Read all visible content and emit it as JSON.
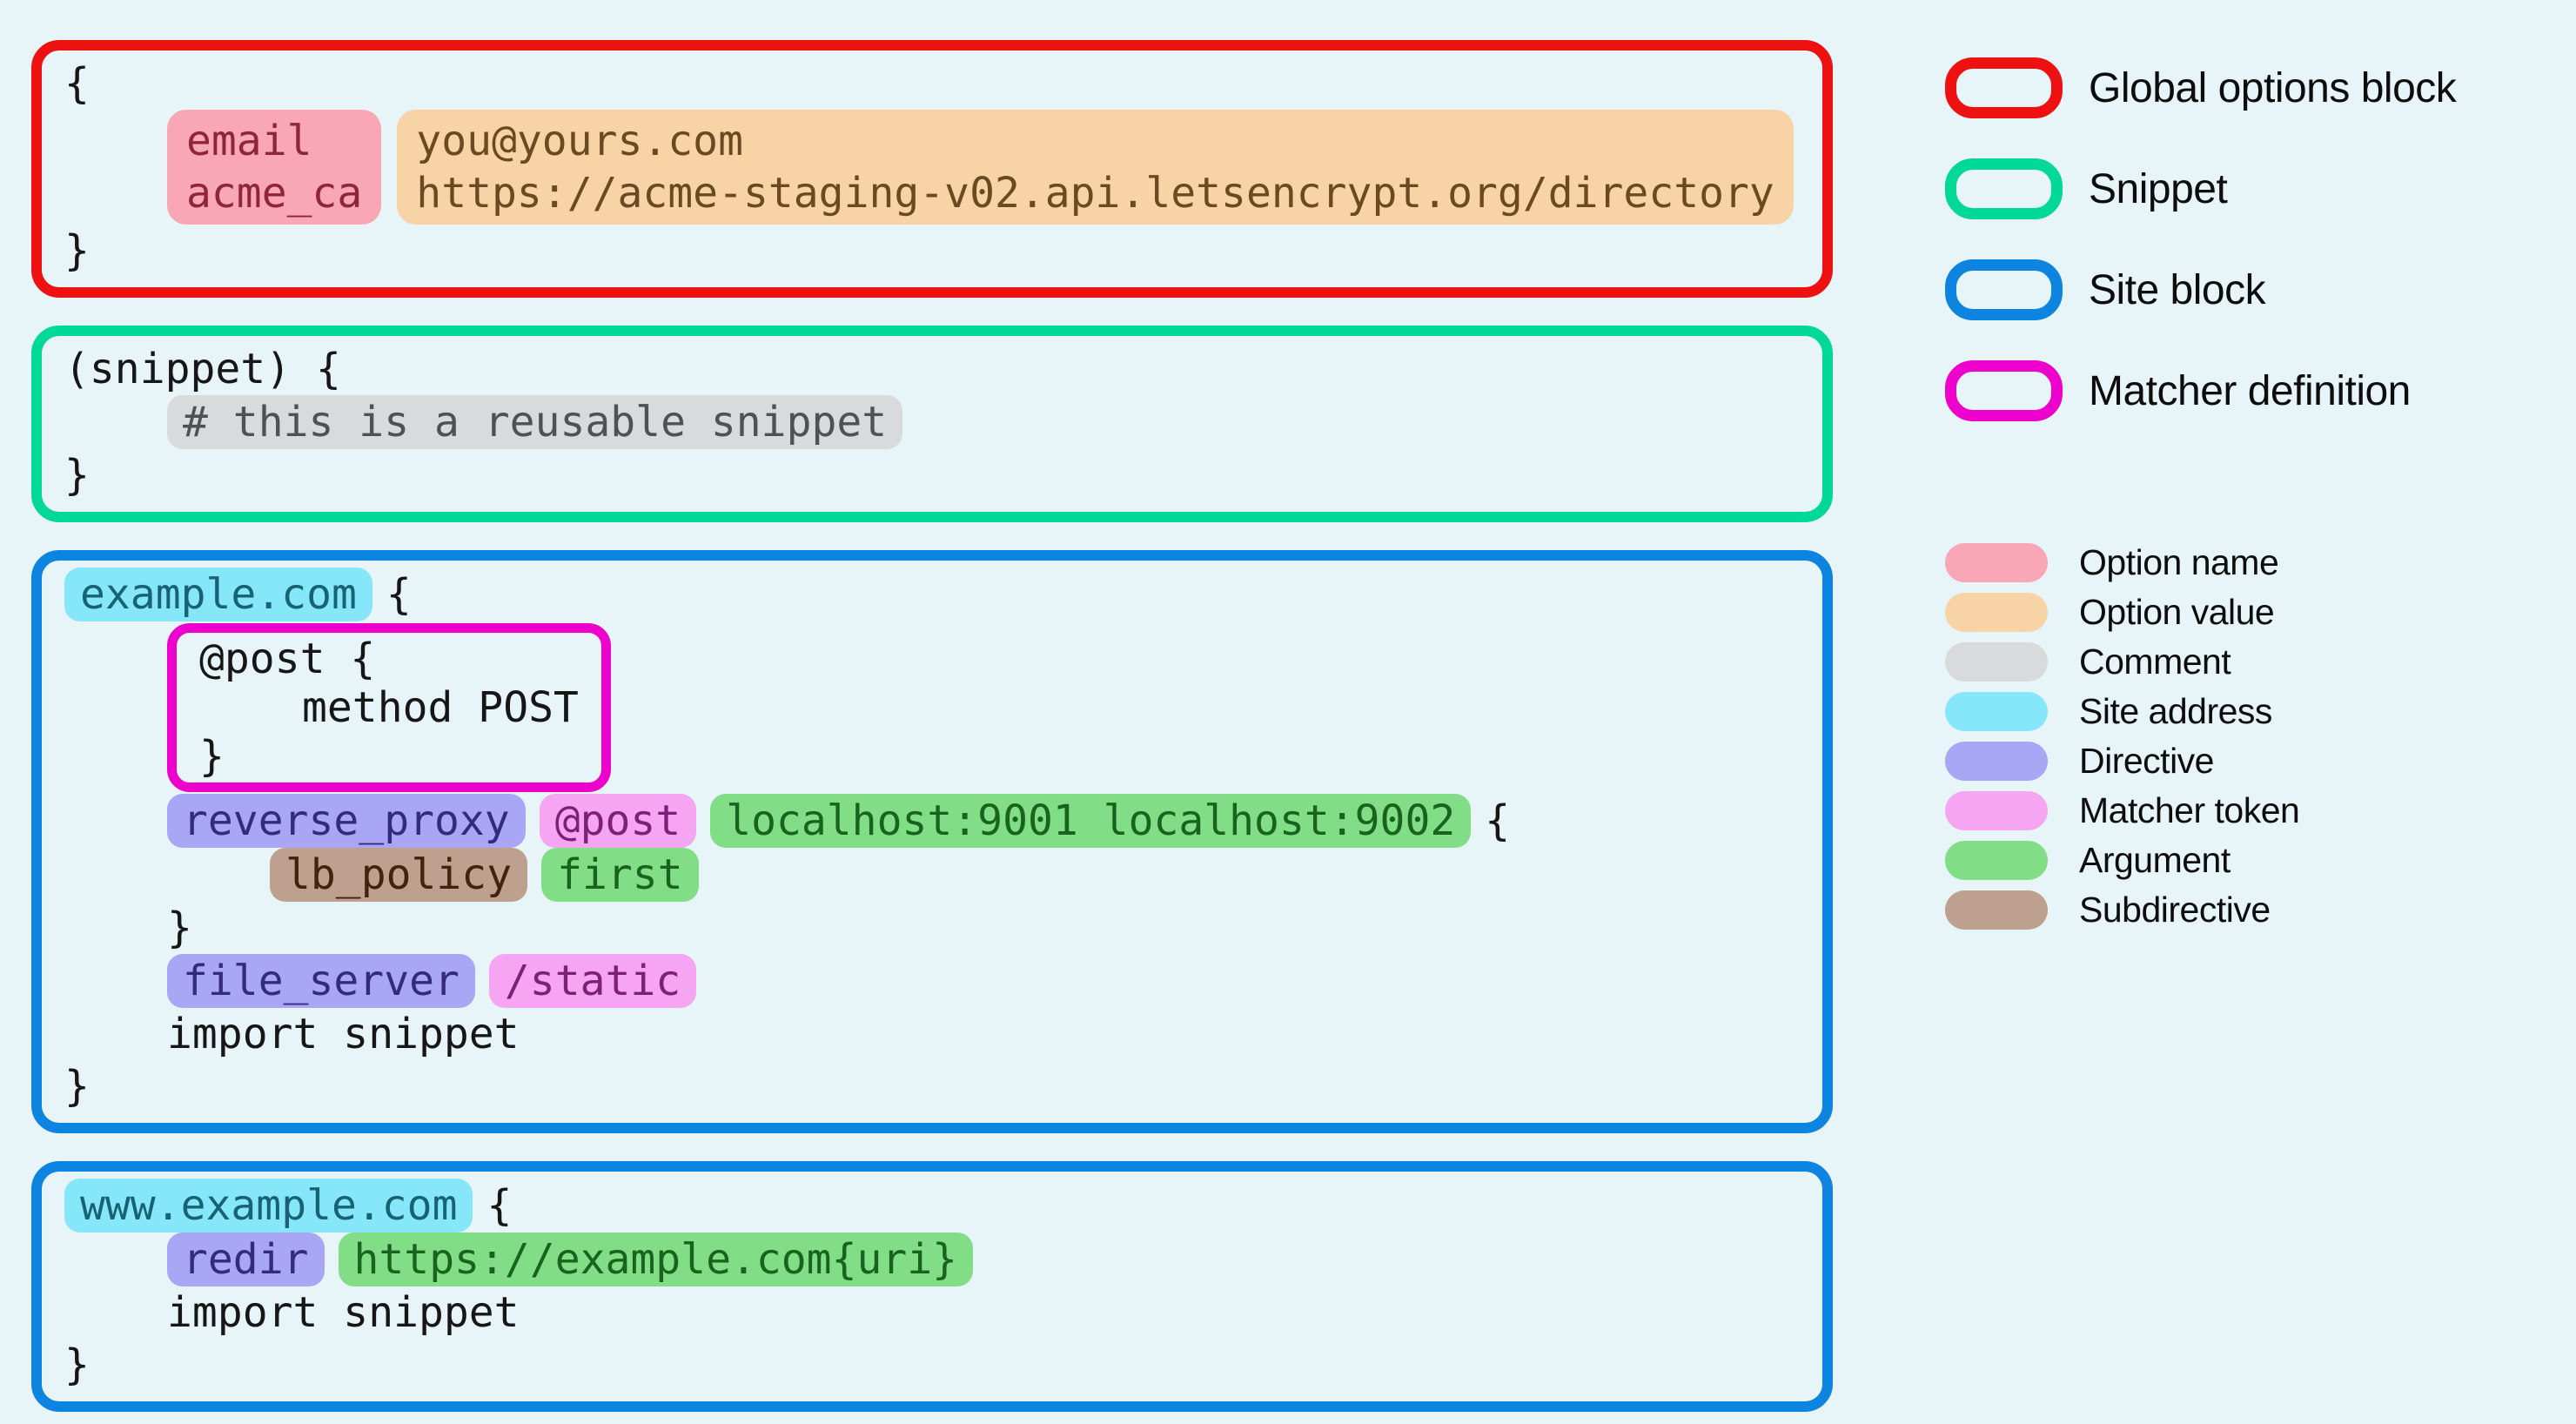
{
  "page": {
    "background": "#e7f4f8"
  },
  "palette": {
    "global_border": "#ee1111",
    "snippet_border": "#00d996",
    "site_border": "#0c84e0",
    "matcher_border": "#ee00cc",
    "code_text": "#161616",
    "option_name_bg": "#f9a7b6",
    "option_name_fg": "#8e2638",
    "option_value_bg": "#f8d3a5",
    "option_value_fg": "#6a4a22",
    "comment_bg": "#d8dadb",
    "comment_fg": "#4d5255",
    "site_address_bg": "#87e7fa",
    "site_address_fg": "#186373",
    "directive_bg": "#a8a6f5",
    "directive_fg": "#342b80",
    "matcher_token_bg": "#f6a5f3",
    "matcher_token_fg": "#7d2078",
    "argument_bg": "#81dd86",
    "argument_fg": "#18641f",
    "subdirective_bg": "#bda08e",
    "subdirective_fg": "#45220e"
  },
  "code": {
    "global_block": {
      "open": "{",
      "options": [
        {
          "name": "email",
          "value": "you@yours.com"
        },
        {
          "name": "acme_ca",
          "value": "https://acme-staging-v02.api.letsencrypt.org/directory"
        }
      ],
      "close": "}"
    },
    "snippet_block": {
      "open": "(snippet) {",
      "comment": "# this is a reusable snippet",
      "close": "}"
    },
    "site_block_1": {
      "address": "example.com",
      "open_brace": "{",
      "matcher_definition": {
        "open": "@post {",
        "body": "method POST",
        "close": "}"
      },
      "proxy_line": {
        "directive": "reverse_proxy",
        "matcher_token": "@post",
        "arguments": "localhost:9001 localhost:9002",
        "open_brace": "{"
      },
      "lb_line": {
        "subdirective": "lb_policy",
        "argument": "first"
      },
      "proxy_close": "}",
      "fileserver_line": {
        "directive": "file_server",
        "matcher_token": "/static"
      },
      "import_line": "import snippet",
      "close": "}"
    },
    "site_block_2": {
      "address": "www.example.com",
      "open_brace": "{",
      "redir_line": {
        "directive": "redir",
        "argument": "https://example.com{uri}"
      },
      "import_line": "import snippet",
      "close": "}"
    }
  },
  "legend": {
    "blocks": [
      {
        "label": "Global options block",
        "color": "#ee1111"
      },
      {
        "label": "Snippet",
        "color": "#00d996"
      },
      {
        "label": "Site block",
        "color": "#0c84e0"
      },
      {
        "label": "Matcher definition",
        "color": "#ee00cc"
      }
    ],
    "tokens": [
      {
        "label": "Option name",
        "color": "#f9a7b6"
      },
      {
        "label": "Option value",
        "color": "#f8d3a5"
      },
      {
        "label": "Comment",
        "color": "#d8dadb"
      },
      {
        "label": "Site address",
        "color": "#87e7fa"
      },
      {
        "label": "Directive",
        "color": "#a8a6f5"
      },
      {
        "label": "Matcher token",
        "color": "#f6a5f3"
      },
      {
        "label": "Argument",
        "color": "#81dd86"
      },
      {
        "label": "Subdirective",
        "color": "#bda08e"
      }
    ]
  }
}
